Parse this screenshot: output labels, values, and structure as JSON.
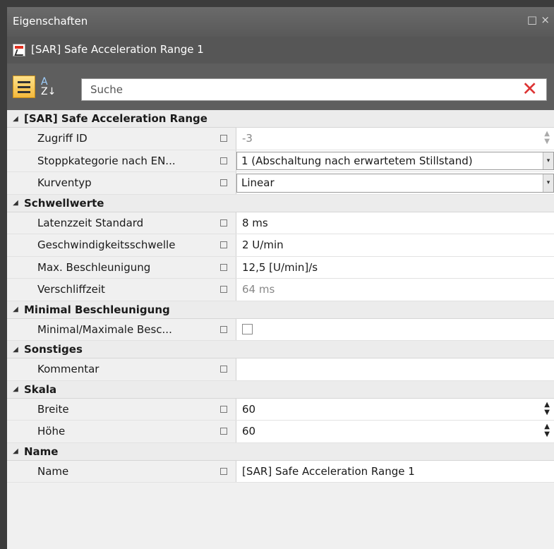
{
  "window": {
    "title": "Eigenschaften",
    "restore_glyph": "□",
    "close_glyph": "×"
  },
  "object": {
    "title": "[SAR] Safe Acceleration Range 1"
  },
  "toolbar": {
    "search_placeholder": "Suche",
    "clear_glyph": "✕",
    "sort_top": "A",
    "sort_bottom": "Z↓"
  },
  "categories": [
    {
      "label": "[SAR] Safe Acceleration Range",
      "props": [
        {
          "name": "Zugriff ID",
          "value": "-3",
          "grey": true,
          "spinner": "light"
        },
        {
          "name": "Stoppkategorie nach EN...",
          "value": "1 (Abschaltung nach erwartetem Stillstand)",
          "dropdown": true
        },
        {
          "name": "Kurventyp",
          "value": "Linear",
          "dropdown": true
        }
      ]
    },
    {
      "label": "Schwellwerte",
      "props": [
        {
          "name": "Latenzzeit Standard",
          "value": "8 ms"
        },
        {
          "name": "Geschwindigkeitsschwelle",
          "value": "2 U/min"
        },
        {
          "name": "Max. Beschleunigung",
          "value": "12,5 [U/min]/s"
        },
        {
          "name": "Verschliffzeit",
          "value": "64 ms",
          "grey": true
        }
      ]
    },
    {
      "label": "Minimal Beschleunigung",
      "props": [
        {
          "name": "Minimal/Maximale Besc...",
          "value": "",
          "checkbox": true,
          "checked": false
        }
      ]
    },
    {
      "label": "Sonstiges",
      "props": [
        {
          "name": "Kommentar",
          "value": ""
        }
      ]
    },
    {
      "label": "Skala",
      "props": [
        {
          "name": "Breite",
          "value": "60",
          "spinner": "dark"
        },
        {
          "name": "Höhe",
          "value": "60",
          "spinner": "dark"
        }
      ]
    },
    {
      "label": "Name",
      "props": [
        {
          "name": "Name",
          "value": "[SAR] Safe Acceleration Range 1"
        }
      ]
    }
  ]
}
